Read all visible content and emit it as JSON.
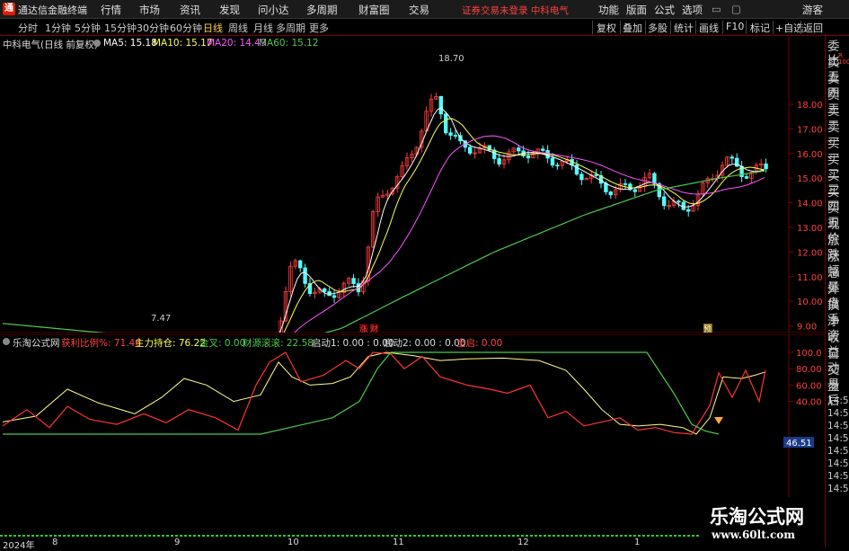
{
  "app_title": "通达信金融终端",
  "menu": [
    "行情",
    "市场",
    "资讯",
    "发现",
    "问小达",
    "多周期",
    "财富圈",
    "交易"
  ],
  "notice": "证券交易未登录  中科电气",
  "menu_right": [
    "功能",
    "版面",
    "公式",
    "选项",
    "游客"
  ],
  "toolbar_left": [
    "分时",
    "1分钟",
    "5分钟",
    "15分钟",
    "30分钟",
    "60分钟",
    "日线",
    "周线",
    "月线",
    "多周期",
    "更多"
  ],
  "toolbar_selected": "日线",
  "toolbar_right": [
    "复权",
    "叠加",
    "多股",
    "统计",
    "画线",
    "F10",
    "标记",
    "+自选",
    "返回"
  ],
  "main": {
    "stock_label": "中科电气(日线 前复权)",
    "ma5": "MA5: 15.18",
    "ma10": "MA10: 15.17",
    "ma20": "MA20: 14.49",
    "ma60": "MA60: 15.12",
    "high_marker": "18.70",
    "low_marker": "7.47",
    "price_ticks": [
      "18.00",
      "17.00",
      "16.00",
      "15.00",
      "14.00",
      "13.00",
      "12.00",
      "11.00",
      "10.00",
      "9.00",
      "8.00"
    ],
    "badges": {
      "zhang": "涨",
      "cai": "财",
      "yu": "预"
    }
  },
  "indicator": {
    "name": "乐淘公式网",
    "ylr": "获利比例%: 71.46",
    "zlcc": "主力持仓: 76.22",
    "jc": "金叉: 0.00",
    "cygg": "财源滚滚: 22.58",
    "qd1": "启动1: 0.00 : 0.00",
    "qd2": "启动2: 0.00 : 0.00",
    "qq": "全启: 0.00",
    "ticks": [
      "100.0",
      "80.00",
      "60.00",
      "40.00"
    ],
    "value_box": "46.51"
  },
  "right_panel": [
    "委比",
    "卖五",
    "卖四",
    "卖三",
    "卖二",
    "卖一",
    "买一",
    "买二",
    "买三",
    "买四",
    "买五",
    "现价",
    "涨跌",
    "涨幅",
    "总量",
    "外盘",
    "换手",
    "净资",
    "收益",
    "自动",
    "交易",
    "盘后",
    "14:56",
    "14:56",
    "14:56",
    "14:56",
    "14:56",
    "14:56",
    "14:56",
    "14:56"
  ],
  "right_small": [
    "R",
    "100"
  ],
  "x_axis": [
    "2024年",
    "8",
    "9",
    "10",
    "11",
    "12",
    "1"
  ],
  "watermark": {
    "title": "乐淘公式网",
    "url": "www.60lt.com"
  },
  "colors": {
    "up": "#ff3c3c",
    "down": "#54fcfc",
    "ma5": "#ffffff",
    "ma10": "#ffff55",
    "ma20": "#ff55ff",
    "ma60": "#4ec94e",
    "grid": "#7a0000"
  }
}
